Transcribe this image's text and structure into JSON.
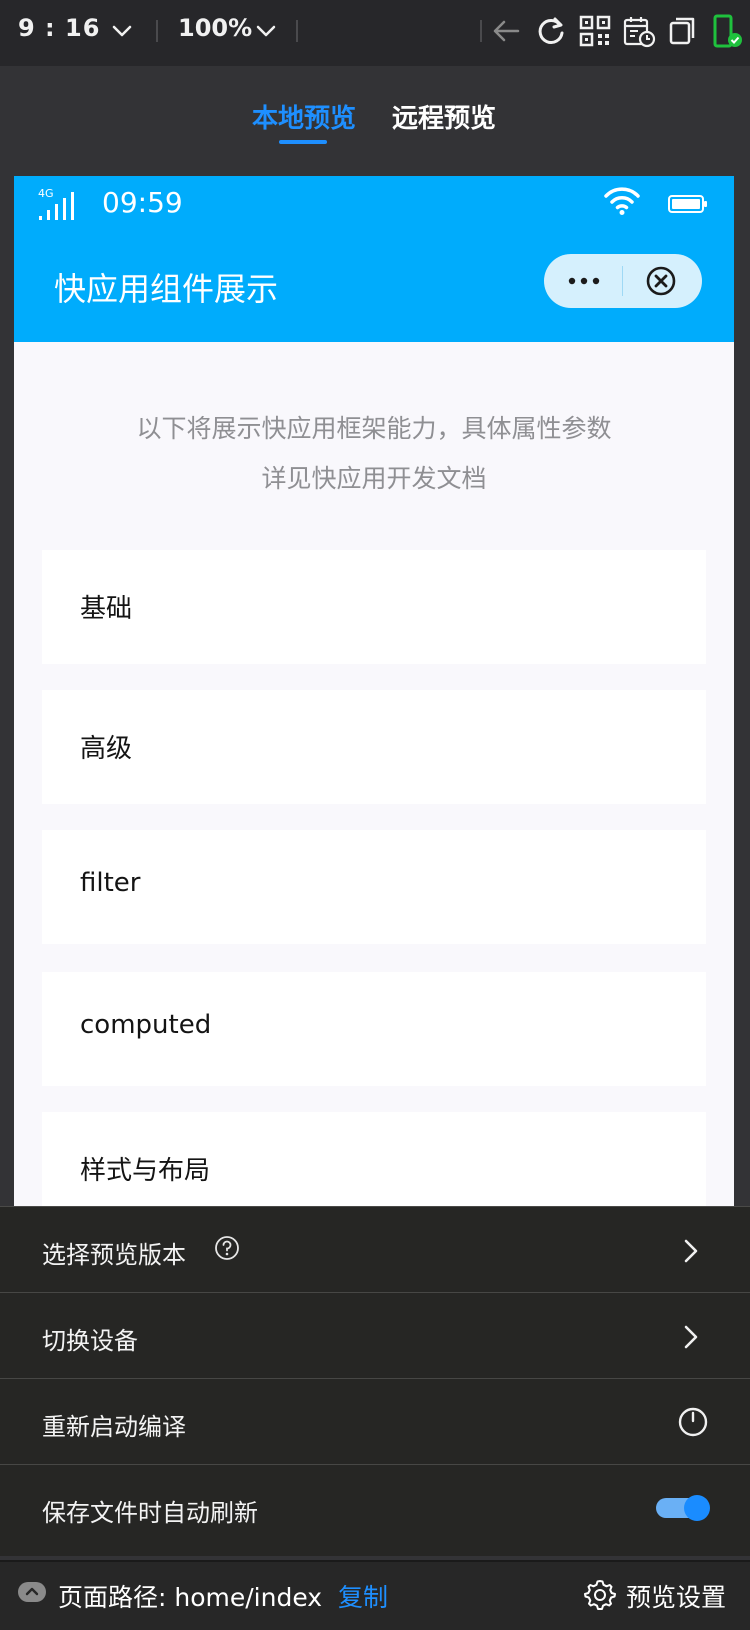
{
  "toolbar": {
    "time": "9 : 16",
    "zoom": "100%"
  },
  "tabs": [
    {
      "label": "本地预览",
      "active": true
    },
    {
      "label": "远程预览",
      "active": false
    }
  ],
  "device": {
    "status_bar": {
      "network": "4G",
      "time": "09:59"
    },
    "app_title": "快应用组件展示",
    "intro_line1": "以下将展示快应用框架能力，具体属性参数",
    "intro_line2": "详见快应用开发文档",
    "items": [
      {
        "label": "基础"
      },
      {
        "label": "高级"
      },
      {
        "label": "filter"
      },
      {
        "label": "computed"
      },
      {
        "label": "样式与布局"
      }
    ]
  },
  "settings": {
    "rows": [
      {
        "label": "选择预览版本",
        "control": "chevron",
        "help": true
      },
      {
        "label": "切换设备",
        "control": "chevron"
      },
      {
        "label": "重新启动编译",
        "control": "refresh"
      },
      {
        "label": "保存文件时自动刷新",
        "control": "toggle",
        "on": true
      }
    ]
  },
  "footer": {
    "path": "页面路径: home/index",
    "copy": "复制",
    "settings": "预览设置"
  },
  "colors": {
    "accent": "#1e8fff",
    "app_bar": "#00acfc",
    "toggle_on": "#1a8cff",
    "status_green": "#1fc13d"
  }
}
